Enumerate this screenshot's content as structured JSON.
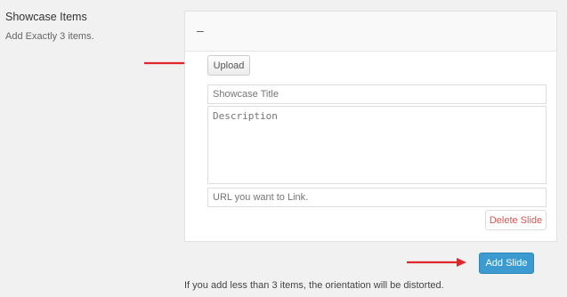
{
  "field": {
    "title": "Showcase Items",
    "description": "Add Exactly 3 items."
  },
  "slide": {
    "toggle_label": "–",
    "upload_label": "Upload",
    "title_placeholder": "Showcase Title",
    "description_placeholder": "Description",
    "url_placeholder": "URL you want to Link.",
    "delete_label": "Delete Slide"
  },
  "add_slide_label": "Add Slide",
  "note": "If you add less than 3 items, the orientation will be distorted.",
  "colors": {
    "arrow": "#e0262a",
    "primary_button": "#3b9bd1",
    "delete_text": "#d9534f"
  },
  "icons": {
    "arrow1": "right-arrow-icon",
    "arrow2": "right-arrow-icon"
  }
}
